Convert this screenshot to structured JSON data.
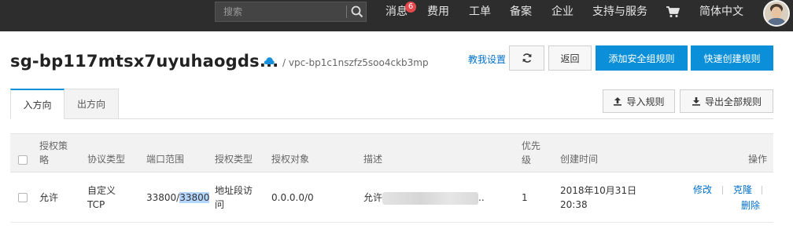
{
  "topbar": {
    "search_placeholder": "搜索",
    "nav": {
      "messages": "消息",
      "messages_badge": "6",
      "billing": "费用",
      "tickets": "工单",
      "filing": "备案",
      "enterprise": "企业",
      "support": "支持与服务",
      "language": "简体中文"
    }
  },
  "header": {
    "title": "sg-bp117mtsx7uyuhaogds...",
    "vpc": "/ vpc-bp1c1nszfz5soo4ckb3mp",
    "help_link": "教我设置",
    "back": "返回",
    "add_rule": "添加安全组规则",
    "quick_create": "快速创建规则"
  },
  "tabs": {
    "inbound": "入方向",
    "outbound": "出方向"
  },
  "toolbar": {
    "import": "导入规则",
    "export": "导出全部规则"
  },
  "table": {
    "columns": {
      "auth_policy": "授权策略",
      "protocol": "协议类型",
      "port_range": "端口范围",
      "auth_type": "授权类型",
      "auth_object": "授权对象",
      "description": "描述",
      "priority": "优先级",
      "created": "创建时间",
      "actions": "操作"
    },
    "rows": [
      {
        "policy": "允许",
        "protocol": "自定义 TCP",
        "port_start": "33800/",
        "port_end": "33800",
        "auth_type": "地址段访问",
        "auth_object": "0.0.0.0/0",
        "description": "允许",
        "description_tail": "..",
        "priority": "1",
        "created": "2018年10月31日 20:38",
        "edit": "修改",
        "clone": "克隆",
        "delete": "删除"
      }
    ]
  }
}
